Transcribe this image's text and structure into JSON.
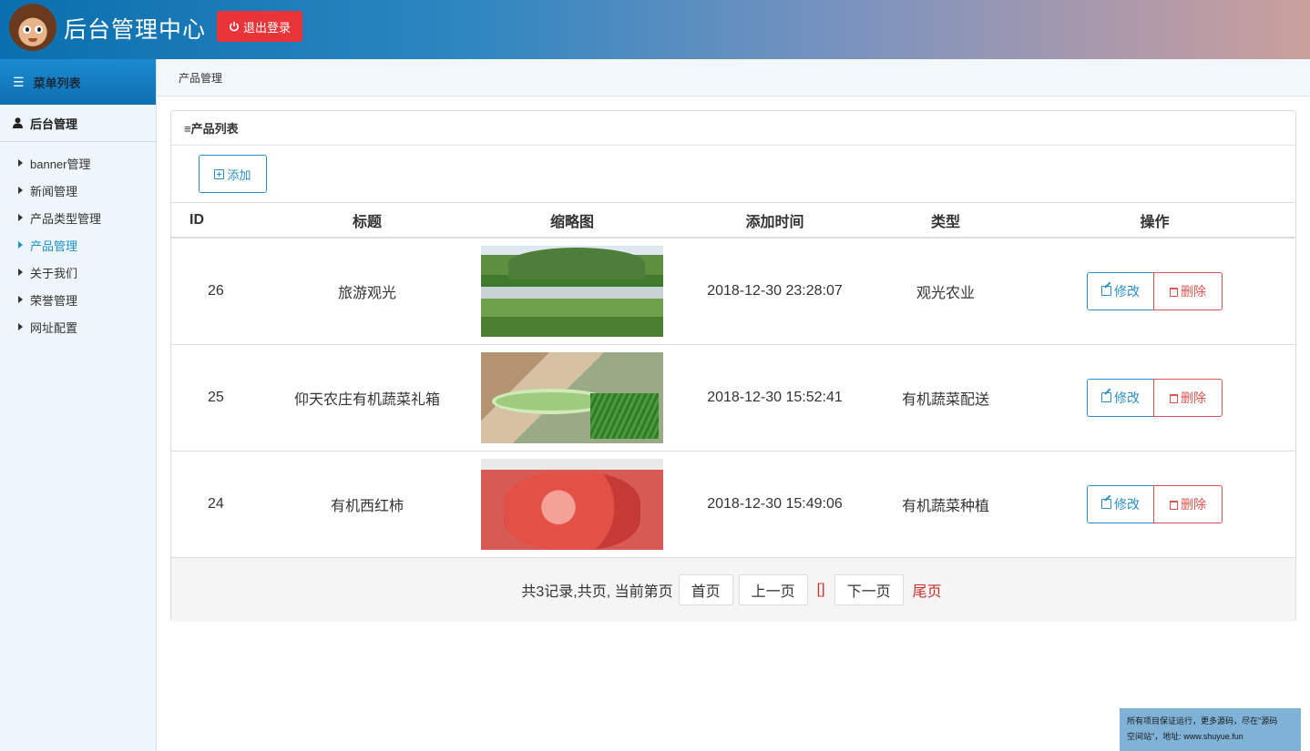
{
  "header": {
    "title": "后台管理中心",
    "logout_label": "退出登录",
    "background_color": "#2c86c0",
    "logout_color": "#e9343a"
  },
  "sidebar": {
    "menu_title": "菜单列表",
    "group_title": "后台管理",
    "items": [
      {
        "label": "banner管理",
        "active": false
      },
      {
        "label": "新闻管理",
        "active": false
      },
      {
        "label": "产品类型管理",
        "active": false
      },
      {
        "label": "产品管理",
        "active": true
      },
      {
        "label": "关于我们",
        "active": false
      },
      {
        "label": "荣誉管理",
        "active": false
      },
      {
        "label": "网址配置",
        "active": false
      }
    ]
  },
  "breadcrumb": "产品管理",
  "panel": {
    "title": "≡产品列表",
    "add_label": "添加"
  },
  "table": {
    "headers": [
      "ID",
      "标题",
      "缩略图",
      "添加时间",
      "类型",
      "操作"
    ],
    "rows": [
      {
        "id": "26",
        "title": "旅游观光",
        "time": "2018-12-30 23:28:07",
        "type": "观光农业"
      },
      {
        "id": "25",
        "title": "仰天农庄有机蔬菜礼箱",
        "time": "2018-12-30 15:52:41",
        "type": "有机蔬菜配送"
      },
      {
        "id": "24",
        "title": "有机西红柿",
        "time": "2018-12-30 15:49:06",
        "type": "有机蔬菜种植"
      }
    ],
    "edit_label": "修改",
    "delete_label": "删除"
  },
  "pager": {
    "summary": "共3记录,共页, 当前第页",
    "first": "首页",
    "prev": "上一页",
    "current": "[]",
    "next": "下一页",
    "last": "尾页"
  },
  "watermark": {
    "line1": "所有项目保证运行，更多源码，尽在\"源码",
    "line2": "空间站\"，地址: www.shuyue.fun"
  }
}
